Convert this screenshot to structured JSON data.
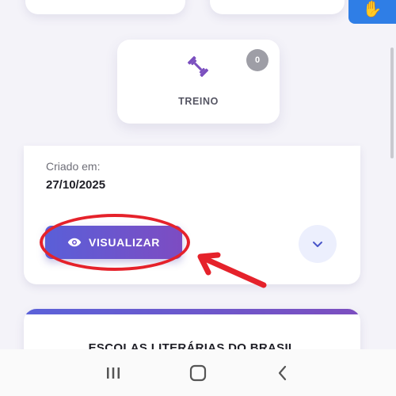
{
  "category": {
    "label": "TREINO",
    "count": "0",
    "icon": "dumbbell-icon"
  },
  "item": {
    "created_label": "Criado em:",
    "created_date": "27/10/2025",
    "view_button_label": "VISUALIZAR",
    "expand_icon": "chevron-down-icon"
  },
  "banner": {
    "title": "ESCOLAS LITERÁRIAS DO BRASIL"
  },
  "accessibility": {
    "icon": "sign-language-icon"
  },
  "system_nav": {
    "buttons": [
      "recent-apps",
      "home",
      "back"
    ]
  },
  "colors": {
    "accent": "#6a55d0",
    "highlight": "#e5222b",
    "access": "#2f7ee6"
  }
}
